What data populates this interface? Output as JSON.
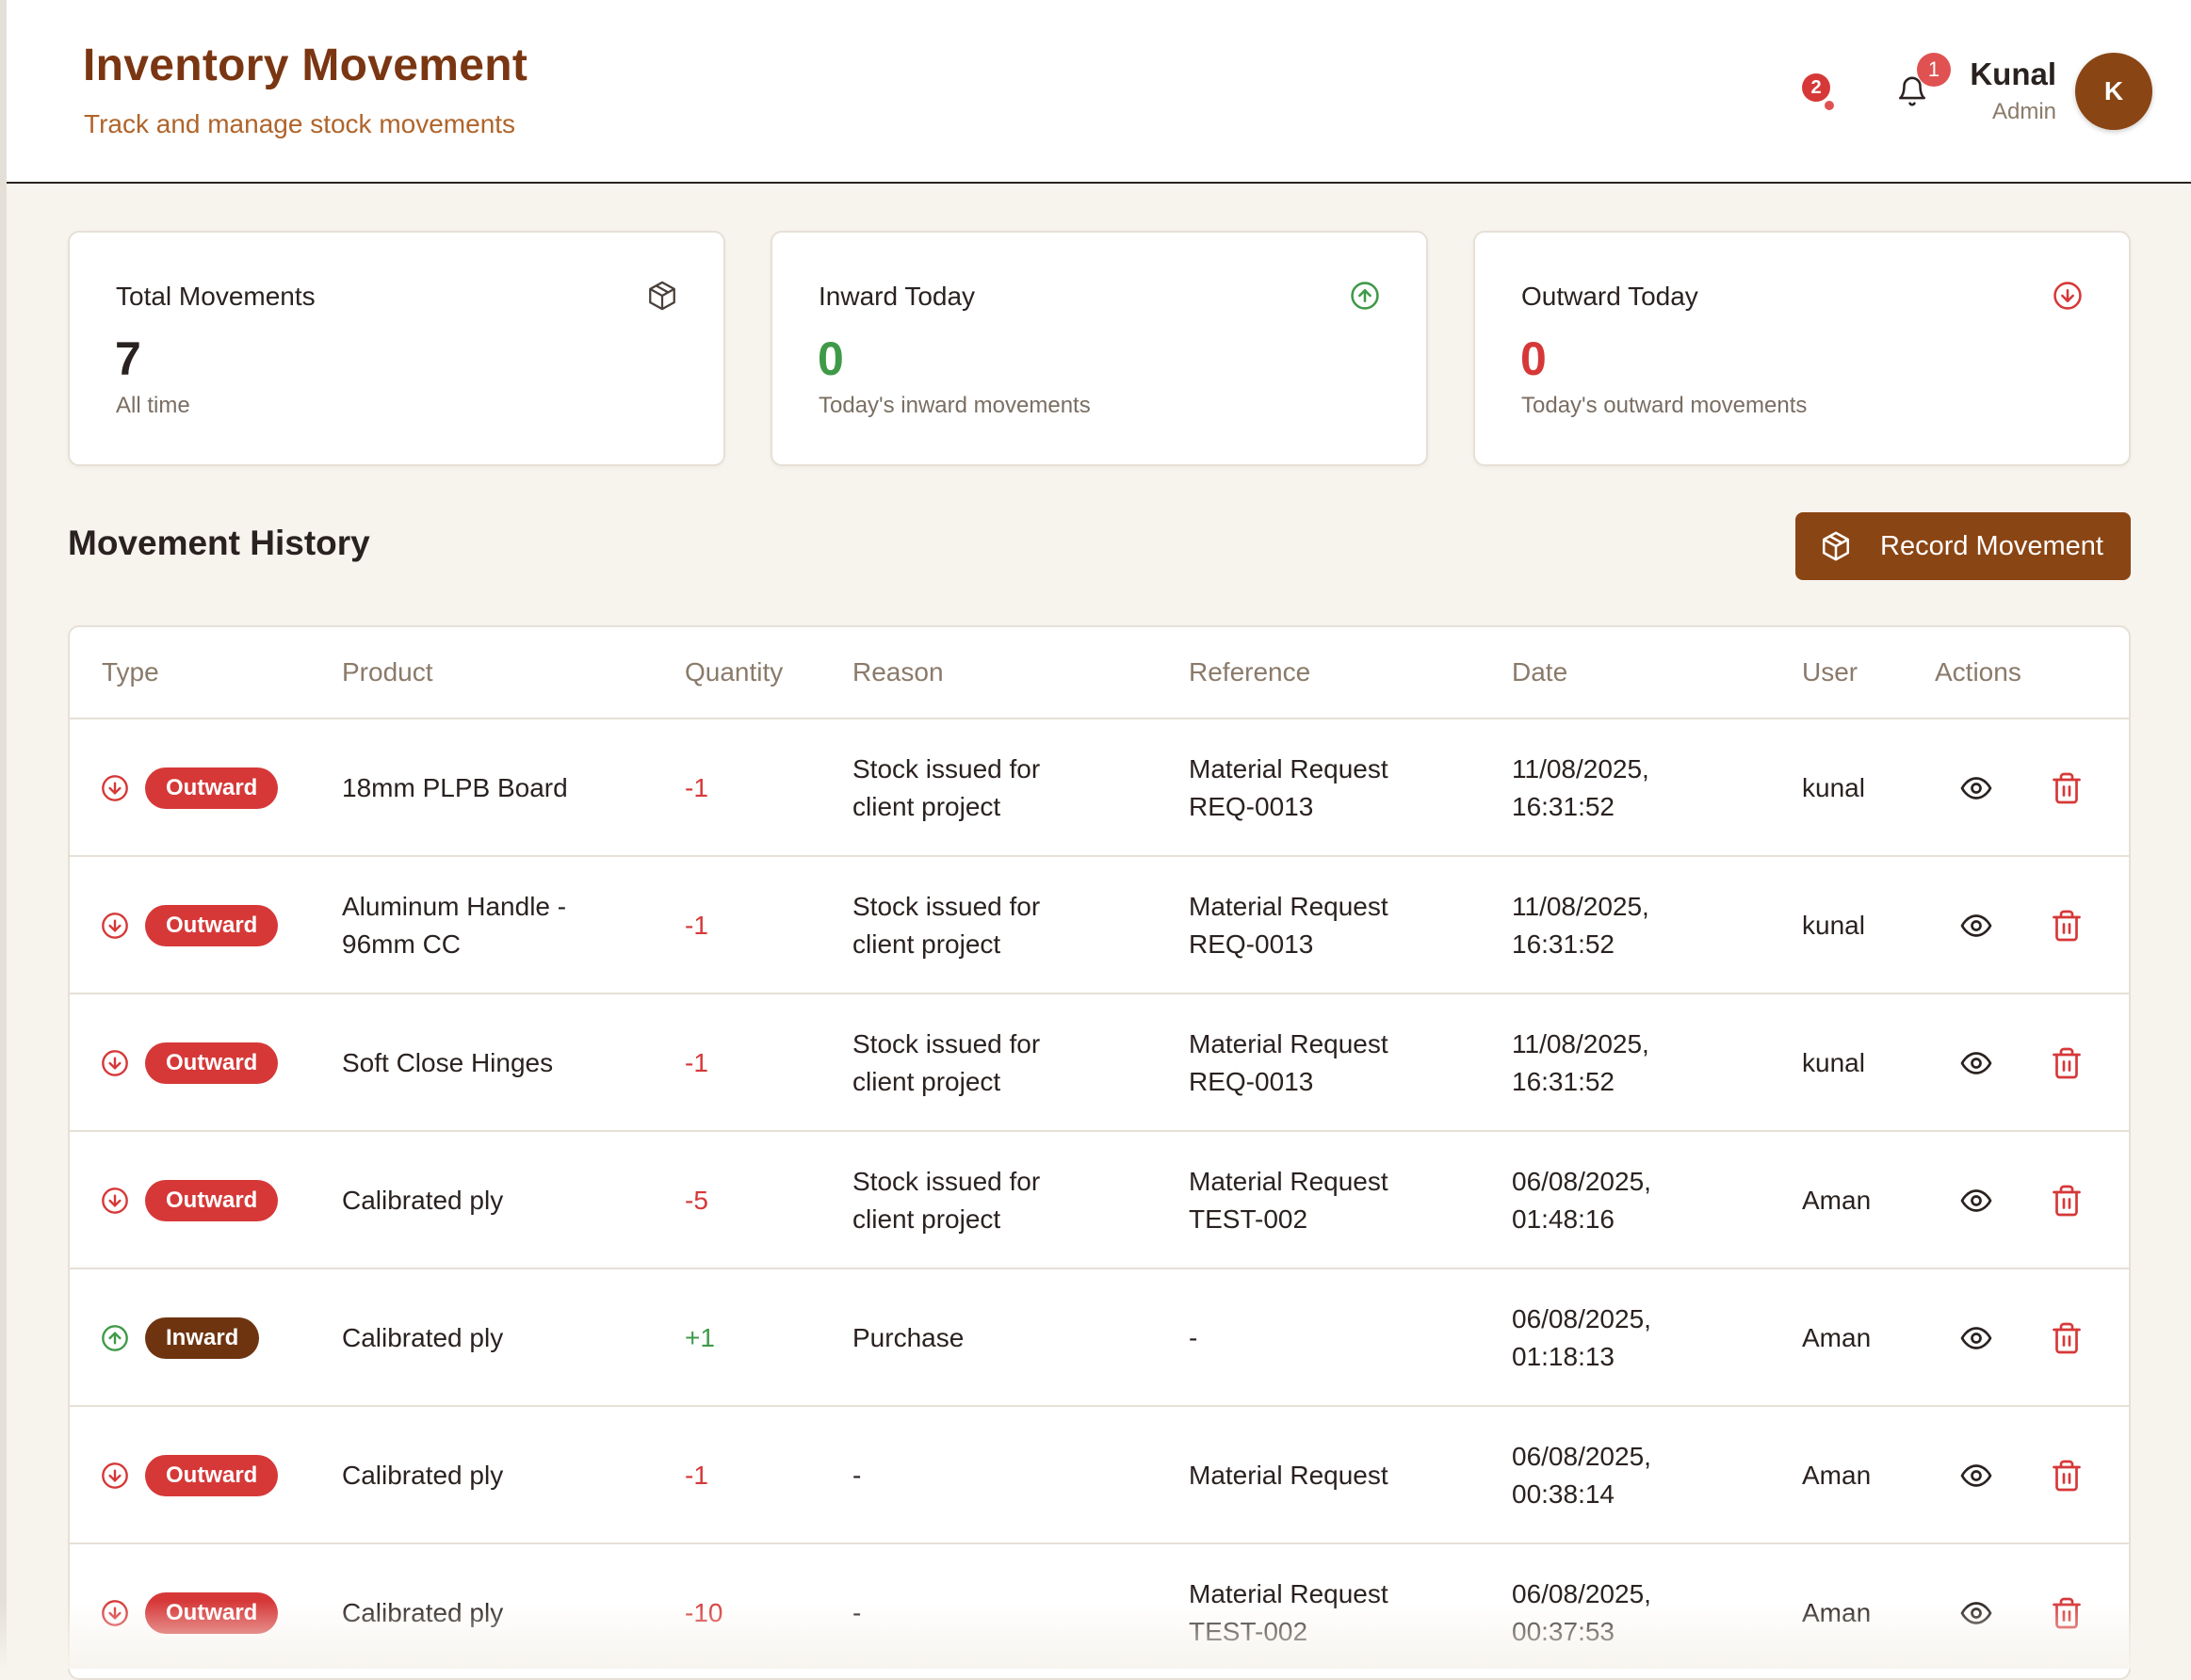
{
  "header": {
    "title": "Inventory Movement",
    "subtitle": "Track and manage stock movements",
    "alert_count": "2",
    "notification_count": "1",
    "user_name": "Kunal",
    "user_role": "Admin",
    "avatar_initial": "K"
  },
  "stats": [
    {
      "title": "Total Movements",
      "value": "7",
      "desc": "All time",
      "icon": "cube-icon",
      "color": "#2a2220"
    },
    {
      "title": "Inward Today",
      "value": "0",
      "desc": "Today's inward movements",
      "icon": "arrow-up-circle-icon",
      "color": "#3f9a48"
    },
    {
      "title": "Outward Today",
      "value": "0",
      "desc": "Today's outward movements",
      "icon": "arrow-down-circle-icon",
      "color": "#d63838"
    }
  ],
  "history": {
    "title": "Movement History",
    "record_button": "Record Movement"
  },
  "table": {
    "columns": [
      "Type",
      "Product",
      "Quantity",
      "Reason",
      "Reference",
      "Date",
      "User",
      "Actions"
    ],
    "rows": [
      {
        "type": "Outward",
        "product": [
          "18mm PLPB Board"
        ],
        "quantity": "-1",
        "reason": [
          "Stock issued for",
          "client project"
        ],
        "reference": [
          "Material Request",
          "REQ-0013"
        ],
        "date": [
          "11/08/2025,",
          "16:31:52"
        ],
        "user": "kunal"
      },
      {
        "type": "Outward",
        "product": [
          "Aluminum Handle -",
          "96mm CC"
        ],
        "quantity": "-1",
        "reason": [
          "Stock issued for",
          "client project"
        ],
        "reference": [
          "Material Request",
          "REQ-0013"
        ],
        "date": [
          "11/08/2025,",
          "16:31:52"
        ],
        "user": "kunal"
      },
      {
        "type": "Outward",
        "product": [
          "Soft Close Hinges"
        ],
        "quantity": "-1",
        "reason": [
          "Stock issued for",
          "client project"
        ],
        "reference": [
          "Material Request",
          "REQ-0013"
        ],
        "date": [
          "11/08/2025,",
          "16:31:52"
        ],
        "user": "kunal"
      },
      {
        "type": "Outward",
        "product": [
          "Calibrated ply"
        ],
        "quantity": "-5",
        "reason": [
          "Stock issued for",
          "client project"
        ],
        "reference": [
          "Material Request",
          "TEST-002"
        ],
        "date": [
          "06/08/2025,",
          "01:48:16"
        ],
        "user": "Aman"
      },
      {
        "type": "Inward",
        "product": [
          "Calibrated ply"
        ],
        "quantity": "+1",
        "reason": [
          "Purchase"
        ],
        "reference": [
          "-"
        ],
        "date": [
          "06/08/2025,",
          "01:18:13"
        ],
        "user": "Aman"
      },
      {
        "type": "Outward",
        "product": [
          "Calibrated ply"
        ],
        "quantity": "-1",
        "reason": [
          "-"
        ],
        "reference": [
          "Material Request"
        ],
        "date": [
          "06/08/2025,",
          "00:38:14"
        ],
        "user": "Aman"
      },
      {
        "type": "Outward",
        "product": [
          "Calibrated ply"
        ],
        "quantity": "-10",
        "reason": [
          "-"
        ],
        "reference": [
          "Material Request",
          "TEST-002"
        ],
        "date": [
          "06/08/2025,",
          "00:37:53"
        ],
        "user": "Aman"
      }
    ]
  },
  "colors": {
    "brand": "#8a4514",
    "title": "#7a3612",
    "outward": "#d63838",
    "inward_badge": "#6e3410",
    "inward_icon": "#3f9a48"
  }
}
